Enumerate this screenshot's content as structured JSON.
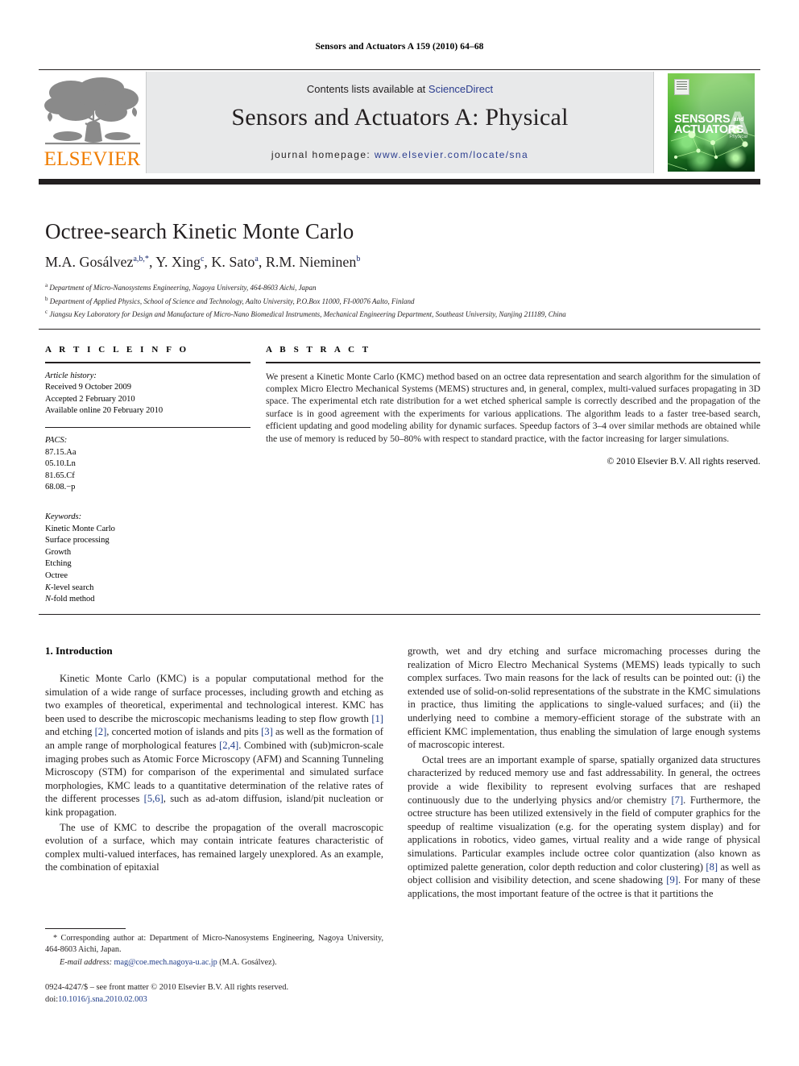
{
  "running_head": "Sensors and Actuators A 159 (2010) 64–68",
  "masthead": {
    "contents_prefix": "Contents lists available at ",
    "sciencedirect": "ScienceDirect",
    "journal_title": "Sensors and Actuators A: Physical",
    "homepage_prefix": "journal homepage: ",
    "homepage_url": "www.elsevier.com/locate/sna",
    "publisher": "ELSEVIER",
    "cover": {
      "line1": "SENSORS",
      "and": "and",
      "line2": "ACTUATORS",
      "letter": "A",
      "subtitle": "Physical"
    },
    "colors": {
      "elsevier_orange": "#f07d00",
      "link_blue": "#2b3d8f",
      "panel_grey": "#e8e9ea",
      "rule_black": "#231f20",
      "cover_green": "#57b93b"
    }
  },
  "article": {
    "title": "Octree-search Kinetic Monte Carlo",
    "authors": "M.A. Gosálvez, Y. Xing, K. Sato, R.M. Nieminen",
    "authors_html": "M.A. Gosálvez<sup>a,b,</sup><sup>*</sup>, Y. Xing<sup>c</sup>, K. Sato<sup>a</sup>, R.M. Nieminen<sup>b</sup>",
    "affiliations": [
      {
        "marker": "a",
        "text": "Department of Micro-Nanosystems Engineering, Nagoya University, 464-8603 Aichi, Japan"
      },
      {
        "marker": "b",
        "text": "Department of Applied Physics, School of Science and Technology, Aalto University, P.O.Box 11000, FI-00076 Aalto, Finland"
      },
      {
        "marker": "c",
        "text": "Jiangsu Key Laboratory for Design and Manufacture of Micro-Nano Biomedical Instruments, Mechanical Engineering Department, Southeast University, Nanjing 211189, China"
      }
    ]
  },
  "info": {
    "heading": "A R T I C L E    I N F O",
    "history_label": "Article history:",
    "history": [
      "Received 9 October 2009",
      "Accepted 2 February 2010",
      "Available online 20 February 2010"
    ],
    "pacs_label": "PACS:",
    "pacs": [
      "87.15.Aa",
      "05.10.Ln",
      "81.65.Cf",
      "68.08.−p"
    ],
    "keywords_label": "Keywords:",
    "keywords": [
      "Kinetic Monte Carlo",
      "Surface processing",
      "Growth",
      "Etching",
      "Octree",
      "K-level search",
      "N-fold method"
    ]
  },
  "abstract": {
    "heading": "A B S T R A C T",
    "text": "We present a Kinetic Monte Carlo (KMC) method based on an octree data representation and search algorithm for the simulation of complex Micro Electro Mechanical Systems (MEMS) structures and, in general, complex, multi-valued surfaces propagating in 3D space. The experimental etch rate distribution for a wet etched spherical sample is correctly described and the propagation of the surface is in good agreement with the experiments for various applications. The algorithm leads to a faster tree-based search, efficient updating and good modeling ability for dynamic surfaces. Speedup factors of 3–4 over similar methods are obtained while the use of memory is reduced by 50–80% with respect to standard practice, with the factor increasing for larger simulations.",
    "copyright": "© 2010 Elsevier B.V. All rights reserved."
  },
  "body": {
    "section_heading": "1.  Introduction",
    "left_paragraphs": [
      "Kinetic Monte Carlo (KMC) is a popular computational method for the simulation of a wide range of surface processes, including growth and etching as two examples of theoretical, experimental and technological interest. KMC has been used to describe the microscopic mechanisms leading to step flow growth [1] and etching [2], concerted motion of islands and pits [3] as well as the formation of an ample range of morphological features [2,4]. Combined with (sub)micron-scale imaging probes such as Atomic Force Microscopy (AFM) and Scanning Tunneling Microscopy (STM) for comparison of the experimental and simulated surface morphologies, KMC leads to a quantitative determination of the relative rates of the different processes [5,6], such as ad-atom diffusion, island/pit nucleation or kink propagation.",
      "The use of KMC to describe the propagation of the overall macroscopic evolution of a surface, which may contain intricate features characteristic of complex multi-valued interfaces, has remained largely unexplored. As an example, the combination of epitaxial"
    ],
    "right_paragraphs": [
      "growth, wet and dry etching and surface micromaching processes during the realization of Micro Electro Mechanical Systems (MEMS) leads typically to such complex surfaces. Two main reasons for the lack of results can be pointed out: (i) the extended use of solid-on-solid representations of the substrate in the KMC simulations in practice, thus limiting the applications to single-valued surfaces; and (ii) the underlying need to combine a memory-efficient storage of the substrate with an efficient KMC implementation, thus enabling the simulation of large enough systems of macroscopic interest.",
      "Octal trees are an important example of sparse, spatially organized data structures characterized by reduced memory use and fast addressability. In general, the octrees provide a wide flexibility to represent evolving surfaces that are reshaped continuously due to the underlying physics and/or chemistry [7]. Furthermore, the octree structure has been utilized extensively in the field of computer graphics for the speedup of realtime visualization (e.g. for the operating system display) and for applications in robotics, video games, virtual reality and a wide range of physical simulations. Particular examples include octree color quantization (also known as optimized palette generation, color depth reduction and color clustering) [8] as well as object collision and visibility detection, and scene shadowing [9]. For many of these applications, the most important feature of the octree is that it partitions the"
    ]
  },
  "footnotes": {
    "corresponding": "* Corresponding author at: Department of Micro-Nanosystems Engineering, Nagoya University, 464-8603 Aichi, Japan.",
    "email_label": "E-mail address:",
    "email": "mag@coe.mech.nagoya-u.ac.jp",
    "email_owner": "(M.A. Gosálvez).",
    "imprint_line": "0924-4247/$ – see front matter © 2010 Elsevier B.V. All rights reserved.",
    "doi_label": "doi:",
    "doi": "10.1016/j.sna.2010.02.003"
  }
}
